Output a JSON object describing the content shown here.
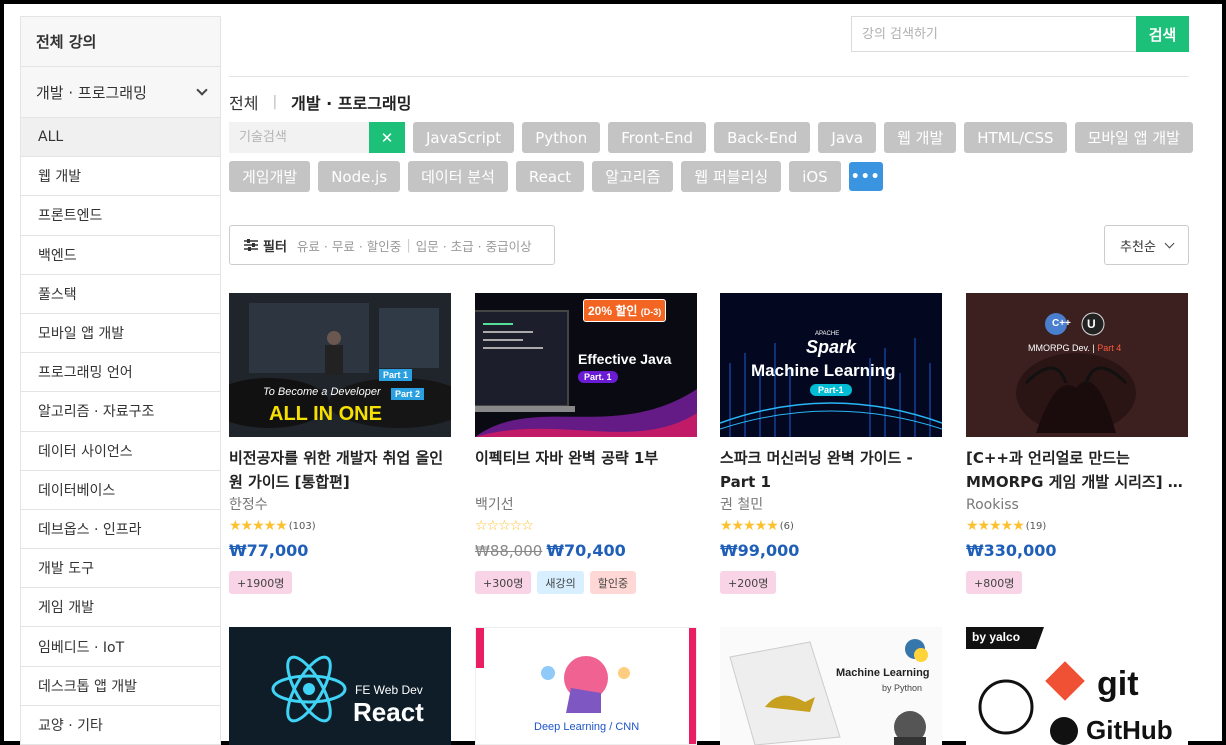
{
  "sidebar": {
    "header": "전체 강의",
    "category": "개발 · 프로그래밍",
    "items": [
      "ALL",
      "웹 개발",
      "프론트엔드",
      "백엔드",
      "풀스택",
      "모바일 앱 개발",
      "프로그래밍 언어",
      "알고리즘 · 자료구조",
      "데이터 사이언스",
      "데이터베이스",
      "데브옵스 · 인프라",
      "개발 도구",
      "게임 개발",
      "임베디드 · IoT",
      "데스크톱 앱 개발",
      "교양 · 기타"
    ]
  },
  "search": {
    "placeholder": "강의 검색하기",
    "button": "검색"
  },
  "breadcrumb": {
    "all": "전체",
    "sep": "|",
    "current": "개발 · 프로그래밍"
  },
  "tag_search": {
    "placeholder": "기술검색",
    "clear": "✕"
  },
  "tags": [
    "JavaScript",
    "Python",
    "Front-End",
    "Back-End",
    "Java",
    "웹 개발",
    "HTML/CSS",
    "모바일 앱 개발",
    "게임개발",
    "Node.js",
    "데이터 분석",
    "React",
    "알고리즘",
    "웹 퍼블리싱",
    "iOS"
  ],
  "tag_more": "•••",
  "filter": {
    "label": "필터",
    "price": [
      "유료",
      "무료",
      "할인중"
    ],
    "level": [
      "입문",
      "초급",
      "중급이상"
    ]
  },
  "sort": {
    "label": "추천순"
  },
  "courses": [
    {
      "title": "비전공자를 위한 개발자 취업 올인원 가이드 [통합편]",
      "instructor": "한정수",
      "stars": "★★★★★",
      "reviews": "(103)",
      "old_price": "",
      "price": "₩77,000",
      "badges": [
        "+1900명"
      ],
      "thumb": {
        "line1": "To Become a Developer",
        "line2": "ALL IN ONE",
        "p1": "Part 1",
        "p2": "Part 2"
      }
    },
    {
      "title": "이펙티브 자바 완벽 공략 1부",
      "instructor": "백기선",
      "stars": "☆☆☆☆☆",
      "reviews": "",
      "old_price": "₩88,000",
      "price": "₩70,400",
      "badges": [
        "+300명",
        "새강의",
        "할인중"
      ],
      "thumb": {
        "sale": "20% 할인",
        "dday": "(D-3)",
        "title": "Effective Java",
        "part": "Part. 1"
      }
    },
    {
      "title": "스파크 머신러닝 완벽 가이드 - Part 1",
      "instructor": "권 철민",
      "stars": "★★★★★",
      "reviews": "(6)",
      "old_price": "",
      "price": "₩99,000",
      "badges": [
        "+200명"
      ],
      "thumb": {
        "brand": "Spark",
        "apache": "APACHE",
        "title": "Machine Learning",
        "part": "Part-1"
      }
    },
    {
      "title": "[C++과 언리얼로 만드는 MMORPG 게임 개발 시리즈] …",
      "instructor": "Rookiss",
      "stars": "★★★★★",
      "reviews": "(19)",
      "old_price": "",
      "price": "₩330,000",
      "badges": [
        "+800명"
      ],
      "thumb": {
        "title": "MMORPG Dev.",
        "part": "Part 4"
      }
    },
    {
      "thumb": {
        "line1": "FE Web Dev",
        "line2": "React"
      }
    },
    {
      "thumb": {
        "title": "Deep Learning / CNN"
      }
    },
    {
      "thumb": {
        "title": "Machine Learning",
        "sub": "by Python"
      }
    },
    {
      "thumb": {
        "by": "by yalco",
        "git": "git",
        "github": "GitHub"
      }
    }
  ],
  "colors": {
    "accent": "#1dc078",
    "price": "#1f5fb8",
    "tag": "#c4c4c4",
    "more": "#3b94e0"
  }
}
